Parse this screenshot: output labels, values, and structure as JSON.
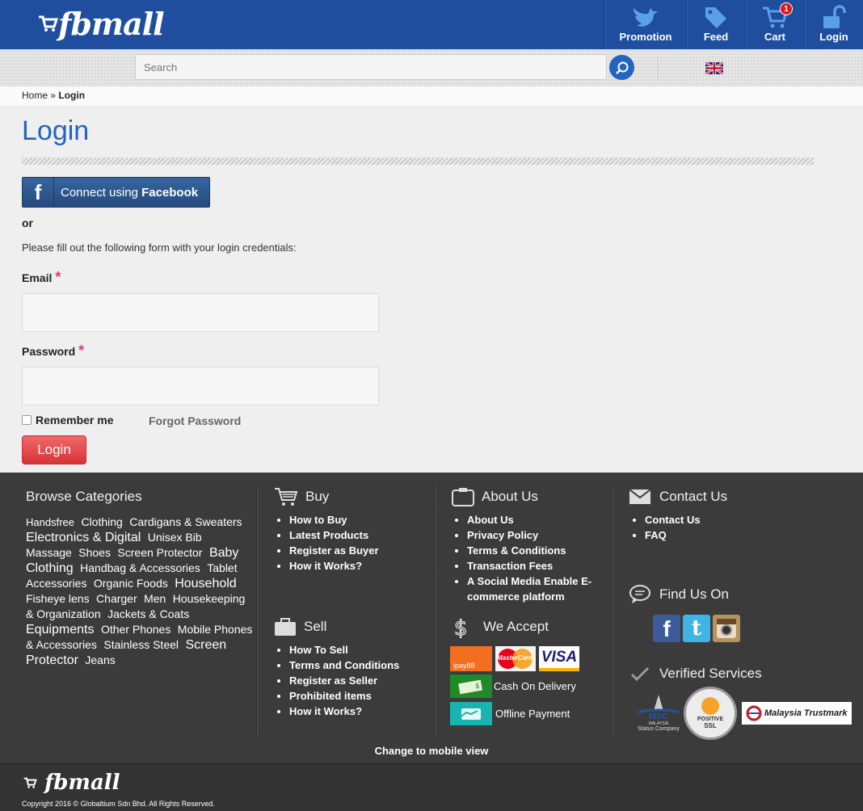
{
  "header": {
    "logo_text": "fbmall",
    "nav": [
      {
        "label": "Promotion",
        "icon": "bird-icon"
      },
      {
        "label": "Feed",
        "icon": "tag-icon"
      },
      {
        "label": "Cart",
        "icon": "cart-icon",
        "badge": "1"
      },
      {
        "label": "Login",
        "icon": "unlock-icon"
      }
    ]
  },
  "search": {
    "placeholder": "Search"
  },
  "breadcrumb": {
    "home": "Home",
    "sep": "»",
    "current": "Login"
  },
  "main": {
    "title": "Login",
    "facebook_prefix": "Connect using ",
    "facebook_bold": "Facebook",
    "or": "or",
    "intro": "Please fill out the following form with your login credentials:",
    "email_label": "Email",
    "password_label": "Password",
    "required_mark": "*",
    "remember_label": "Remember me",
    "forgot_label": "Forgot Password",
    "login_button": "Login"
  },
  "footer": {
    "browse": {
      "title": "Browse Categories",
      "items": [
        {
          "text": "Handsfree",
          "size": "s"
        },
        {
          "text": "Clothing",
          "size": "m"
        },
        {
          "text": "Cardigans & Sweaters",
          "size": "m"
        },
        {
          "text": "Electronics & Digital",
          "size": "l"
        },
        {
          "text": "Unisex Bib",
          "size": "m"
        },
        {
          "text": "Massage",
          "size": "m"
        },
        {
          "text": "Shoes",
          "size": "m"
        },
        {
          "text": "Screen Protector",
          "size": "m"
        },
        {
          "text": "Baby Clothing",
          "size": "l"
        },
        {
          "text": "Handbag & Accessories",
          "size": "m"
        },
        {
          "text": "Tablet Accessories",
          "size": "m"
        },
        {
          "text": "Organic Foods",
          "size": "m"
        },
        {
          "text": "Household",
          "size": "l"
        },
        {
          "text": "Fisheye lens",
          "size": "m"
        },
        {
          "text": "Charger",
          "size": "m"
        },
        {
          "text": "Men",
          "size": "m"
        },
        {
          "text": "Housekeeping & Organization",
          "size": "m"
        },
        {
          "text": "Jackets & Coats",
          "size": "m"
        },
        {
          "text": "Equipments",
          "size": "l"
        },
        {
          "text": "Other Phones",
          "size": "m"
        },
        {
          "text": "Mobile Phones & Accessories",
          "size": "m"
        },
        {
          "text": "Stainless Steel",
          "size": "m"
        },
        {
          "text": "Screen Protector",
          "size": "l"
        },
        {
          "text": "Jeans",
          "size": "m"
        }
      ]
    },
    "buy": {
      "title": "Buy",
      "items": [
        "How to Buy",
        "Latest Products",
        "Register as Buyer",
        "How it Works?"
      ]
    },
    "sell": {
      "title": "Sell",
      "items": [
        "How To Sell",
        "Terms and Conditions",
        "Register as Seller",
        "Prohibited items",
        "How it Works?"
      ]
    },
    "about": {
      "title": "About Us",
      "items": [
        "About Us",
        "Privacy Policy",
        "Terms & Conditions",
        "Transaction Fees",
        "A Social Media Enable E-commerce platform"
      ]
    },
    "accept": {
      "title": "We Accept",
      "cod": "Cash On Delivery",
      "offline": "Offline Payment",
      "ipay": "ipay88",
      "mastercard": "MasterCard",
      "visa": "VISA"
    },
    "contact": {
      "title": "Contact Us",
      "items": [
        "Contact Us",
        "FAQ"
      ]
    },
    "find": {
      "title": "Find Us On"
    },
    "verified": {
      "title": "Verified Services",
      "msc": "MSC",
      "msc_sub1": "MALAYSIA",
      "msc_sub2": "Status Company",
      "ssl1": "POSITIVE",
      "ssl2": "SSL",
      "trustmark": "Malaysia Trustmark"
    },
    "mobile_view": "Change to mobile view",
    "bottom_logo": "fbmall",
    "copyright": "Copyright 2016 © Globaltium Sdn Bhd. All Rights Reserved."
  }
}
